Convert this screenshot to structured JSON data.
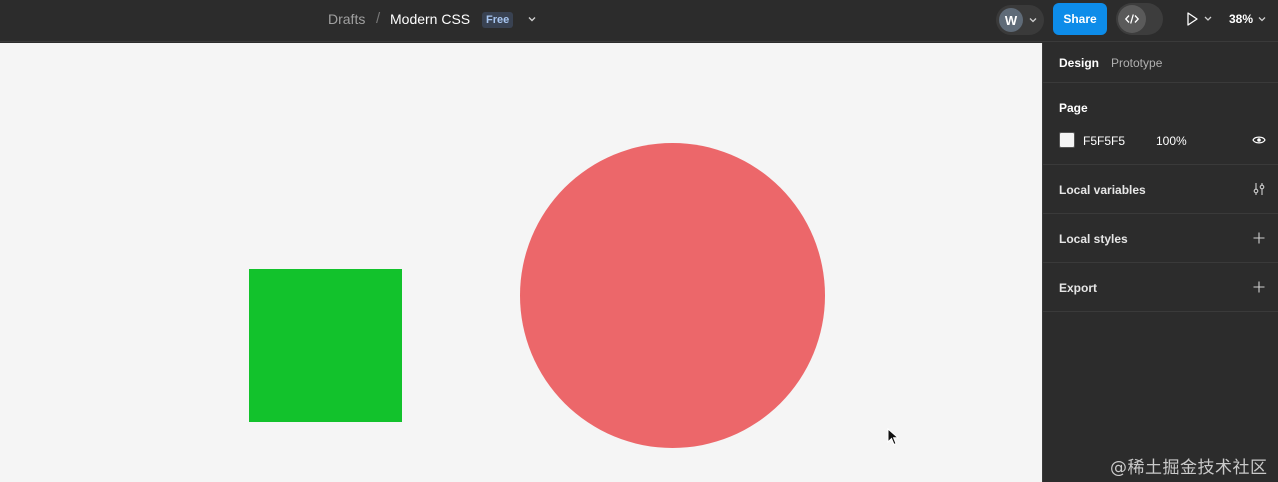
{
  "toolbar": {
    "breadcrumb_parent": "Drafts",
    "breadcrumb_separator": "/",
    "file_name": "Modern CSS",
    "plan_badge": "Free",
    "avatar_initial": "W",
    "share_label": "Share",
    "zoom_level": "38%"
  },
  "panel": {
    "tabs": {
      "design": "Design",
      "prototype": "Prototype"
    },
    "page": {
      "title": "Page",
      "color_hex": "F5F5F5",
      "opacity": "100%"
    },
    "sections": {
      "local_variables": "Local variables",
      "local_styles": "Local styles",
      "export": "Export"
    }
  },
  "canvas": {
    "background": "#F5F5F5",
    "shapes": [
      {
        "name": "rectangle",
        "fill": "#12C22C"
      },
      {
        "name": "ellipse",
        "fill": "#EC676A"
      }
    ]
  },
  "watermark": "@稀土掘金技术社区",
  "colors": {
    "accent": "#0D8CE9",
    "toolbar_bg": "#2C2C2C"
  },
  "icons": [
    "chevron-down-icon",
    "code-icon",
    "play-icon",
    "eye-icon",
    "variables-icon",
    "plus-icon",
    "cursor-icon"
  ]
}
